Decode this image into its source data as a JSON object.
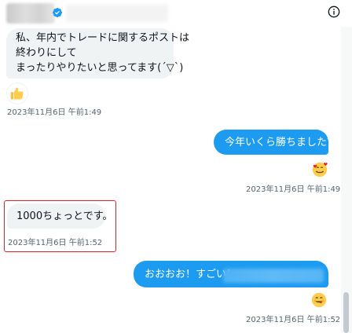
{
  "header": {
    "info_icon": "info-icon",
    "verified_icon": "verified-badge-icon"
  },
  "messages": [
    {
      "side": "left",
      "lines": [
        "私、年内でトレードに関するポストは",
        "終わりにして",
        "まったりやりたいと思ってます(´▽`)"
      ],
      "reaction": "thumbs-up",
      "timestamp": "2023年11月6日 午前1:49"
    },
    {
      "side": "right",
      "text": "今年いくら勝ちました？",
      "reaction": "smiling-face-with-hearts",
      "timestamp": "2023年11月6日 午前1:49"
    },
    {
      "side": "left",
      "text": "1000ちょっとです。",
      "timestamp": "2023年11月6日 午前1:52"
    },
    {
      "side": "right",
      "text": "おおおお！すごい！",
      "reaction": "face-savoring-food",
      "timestamp": "2023年11月6日 午前1:52"
    }
  ],
  "colors": {
    "accent": "#1d9bf0",
    "incoming_bubble": "#eff3f4",
    "highlight_box": "#e0242e",
    "timestamp": "#536471"
  }
}
